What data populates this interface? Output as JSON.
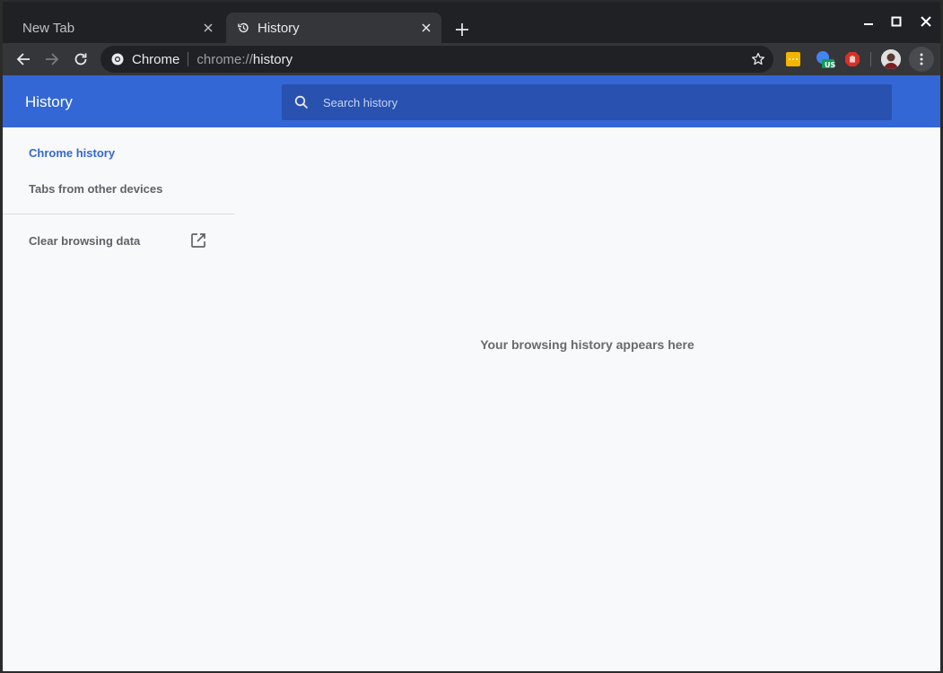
{
  "tabs": [
    {
      "label": "New Tab",
      "active": false
    },
    {
      "label": "History",
      "active": true
    }
  ],
  "omnibox": {
    "origin": "Chrome",
    "url_scheme": "chrome://",
    "url_host": "history"
  },
  "extensions": {
    "vpn_badge": "US"
  },
  "appbar": {
    "title": "History",
    "search_placeholder": "Search history"
  },
  "sidebar": {
    "items": [
      {
        "label": "Chrome history",
        "selected": true
      },
      {
        "label": "Tabs from other devices",
        "selected": false
      }
    ],
    "clear_label": "Clear browsing data"
  },
  "main": {
    "empty_message": "Your browsing history appears here"
  },
  "colors": {
    "accent": "#3367d6",
    "search_bg": "#2851b0",
    "frame": "#202124",
    "toolbar": "#35363a"
  }
}
